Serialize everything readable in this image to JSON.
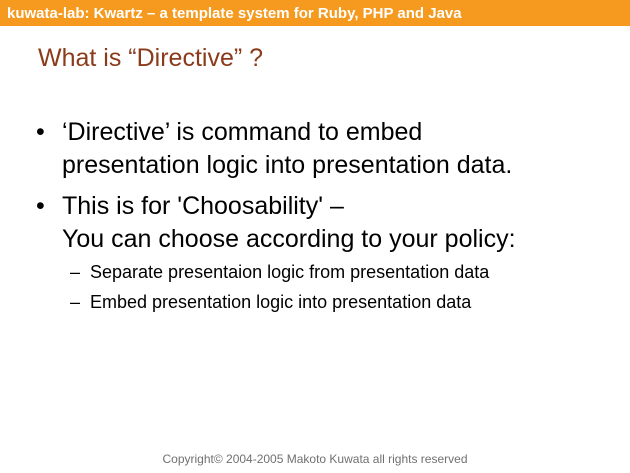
{
  "header": {
    "title": "kuwata-lab:  Kwartz – a template system for Ruby, PHP and Java"
  },
  "slide": {
    "title": "What is “Directive” ?",
    "bullets": [
      {
        "marker": "•",
        "lines": [
          "‘Directive’ is command to embed",
          "presentation logic into presentation data."
        ]
      },
      {
        "marker": "•",
        "lines": [
          "This is for 'Choosability' –",
          "You can choose according to your policy:"
        ],
        "sub_items": [
          {
            "marker": "–",
            "text": "Separate presentaion logic from presentation data"
          },
          {
            "marker": "–",
            "text": "Embed presentation logic into presentation data"
          }
        ]
      }
    ]
  },
  "footer": {
    "copyright": "Copyright© 2004-2005 Makoto Kuwata all rights reserved"
  },
  "colors": {
    "header_bar": "#f59a1f",
    "header_text": "#ffffff",
    "title": "#8b3a1a",
    "footer": "#707070"
  }
}
